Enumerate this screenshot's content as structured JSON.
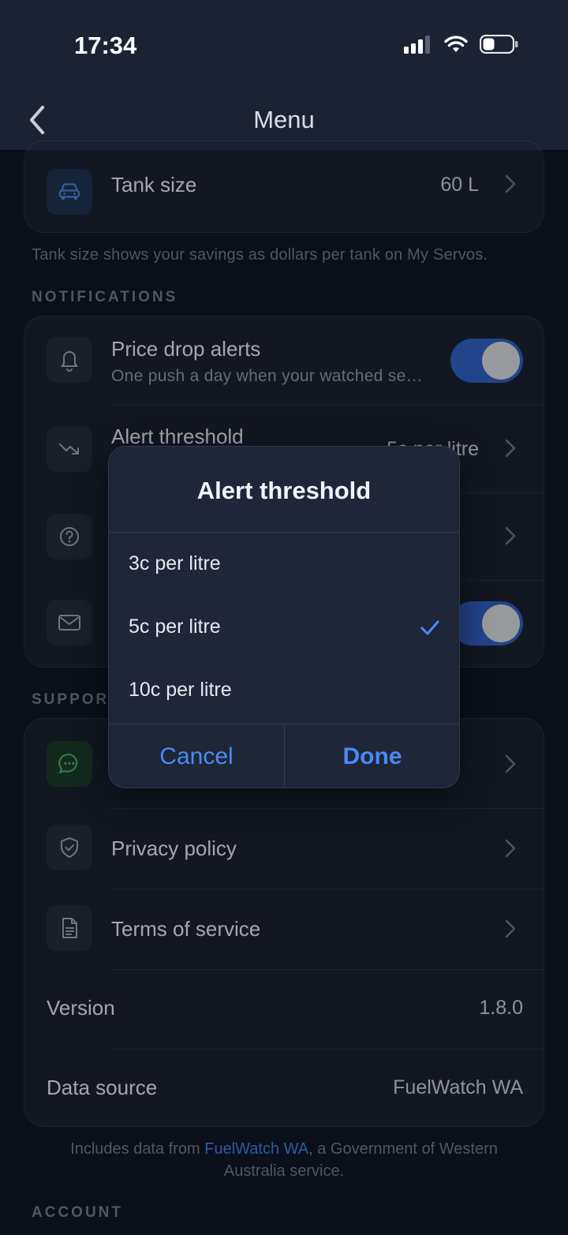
{
  "status": {
    "time": "17:34"
  },
  "nav": {
    "title": "Menu"
  },
  "tank": {
    "title": "Tank size",
    "value": "60 L",
    "footnote": "Tank size shows your savings as dollars per tank on My Servos."
  },
  "notifications": {
    "header": "NOTIFICATIONS",
    "price_drop": {
      "title": "Price drop alerts",
      "sub": "One push a day when your watched se…",
      "on": true
    },
    "threshold": {
      "title": "Alert threshold",
      "value": "5c per litre"
    },
    "email_on": true
  },
  "support": {
    "header": "SUPPORT",
    "privacy": "Privacy policy",
    "terms": "Terms of service",
    "version_label": "Version",
    "version_value": "1.8.0",
    "source_label": "Data source",
    "source_value": "FuelWatch WA"
  },
  "credit": {
    "prefix": "Includes data from ",
    "link": "FuelWatch WA",
    "suffix": ", a Government of Western Australia service."
  },
  "account": {
    "header": "ACCOUNT"
  },
  "dialog": {
    "title": "Alert threshold",
    "options": [
      "3c per litre",
      "5c per litre",
      "10c per litre"
    ],
    "selected_index": 1,
    "cancel": "Cancel",
    "done": "Done"
  }
}
